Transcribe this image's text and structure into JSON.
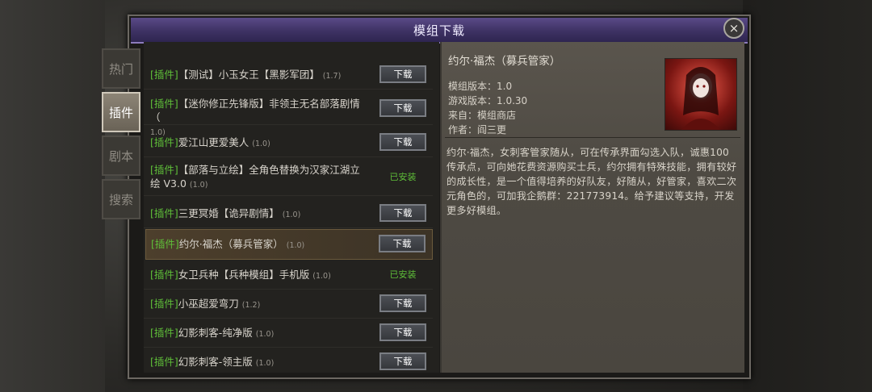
{
  "window": {
    "title": "模组下载",
    "close_label": "×"
  },
  "tabs": [
    {
      "label": "热门",
      "active": false
    },
    {
      "label": "插件",
      "active": true
    },
    {
      "label": "剧本",
      "active": false
    },
    {
      "label": "搜索",
      "active": false
    }
  ],
  "list": [
    {
      "tag": "[插件]",
      "name": "【测试】小玉女王【黑影军团】",
      "name2": "",
      "version": "(1.7)",
      "action": "下载",
      "installed": false,
      "selected": false
    },
    {
      "tag": "[插件]",
      "name": "【迷你修正先锋版】非领主无名部落剧情（",
      "name2": "",
      "version": "1.0)",
      "action": "下载",
      "installed": false,
      "selected": false
    },
    {
      "tag": "[插件]",
      "name": "爱江山更爱美人",
      "name2": "",
      "version": "(1.0)",
      "action": "下载",
      "installed": false,
      "selected": false
    },
    {
      "tag": "[插件]",
      "name": "【部落与立绘】全角色替换为汉家江湖立",
      "name2": "绘 V3.0",
      "version": "(1.0)",
      "action": "已安装",
      "installed": true,
      "selected": false
    },
    {
      "tag": "[插件]",
      "name": "三更冥婚【诡异剧情】",
      "name2": "",
      "version": "(1.0)",
      "action": "下载",
      "installed": false,
      "selected": false
    },
    {
      "tag": "[插件]",
      "name": "约尔·福杰（募兵管家）",
      "name2": "",
      "version": "(1.0)",
      "action": "下载",
      "installed": false,
      "selected": true
    },
    {
      "tag": "[插件]",
      "name": "女卫兵种【兵种模组】手机版",
      "name2": "",
      "version": "(1.0)",
      "action": "已安装",
      "installed": true,
      "selected": false
    },
    {
      "tag": "[插件]",
      "name": "小巫超爱弯刀",
      "name2": "",
      "version": "(1.2)",
      "action": "下载",
      "installed": false,
      "selected": false
    },
    {
      "tag": "[插件]",
      "name": "幻影刺客-纯净版",
      "name2": "",
      "version": "(1.0)",
      "action": "下载",
      "installed": false,
      "selected": false
    },
    {
      "tag": "[插件]",
      "name": "幻影刺客-领主版",
      "name2": "",
      "version": "(1.0)",
      "action": "下载",
      "installed": false,
      "selected": false
    }
  ],
  "detail": {
    "title": "约尔·福杰（募兵管家）",
    "mod_version": "模组版本：1.0",
    "game_version": "游戏版本：1.0.30",
    "source": "来自：模组商店",
    "author": "作者：阎三更",
    "description": "约尔·福杰，女刺客管家随从，可在传承界面勾选入队，诚惠100传承点，可向她花费资源购买士兵，约尔拥有特殊技能，拥有较好的成长性，是一个值得培养的好队友，好随从，好管家，喜欢二次元角色的，可加我企鹅群：221773914。给予建议等支持，开发更多好模组。"
  },
  "icons": {
    "close": "close-icon",
    "portrait": "character-portrait"
  }
}
